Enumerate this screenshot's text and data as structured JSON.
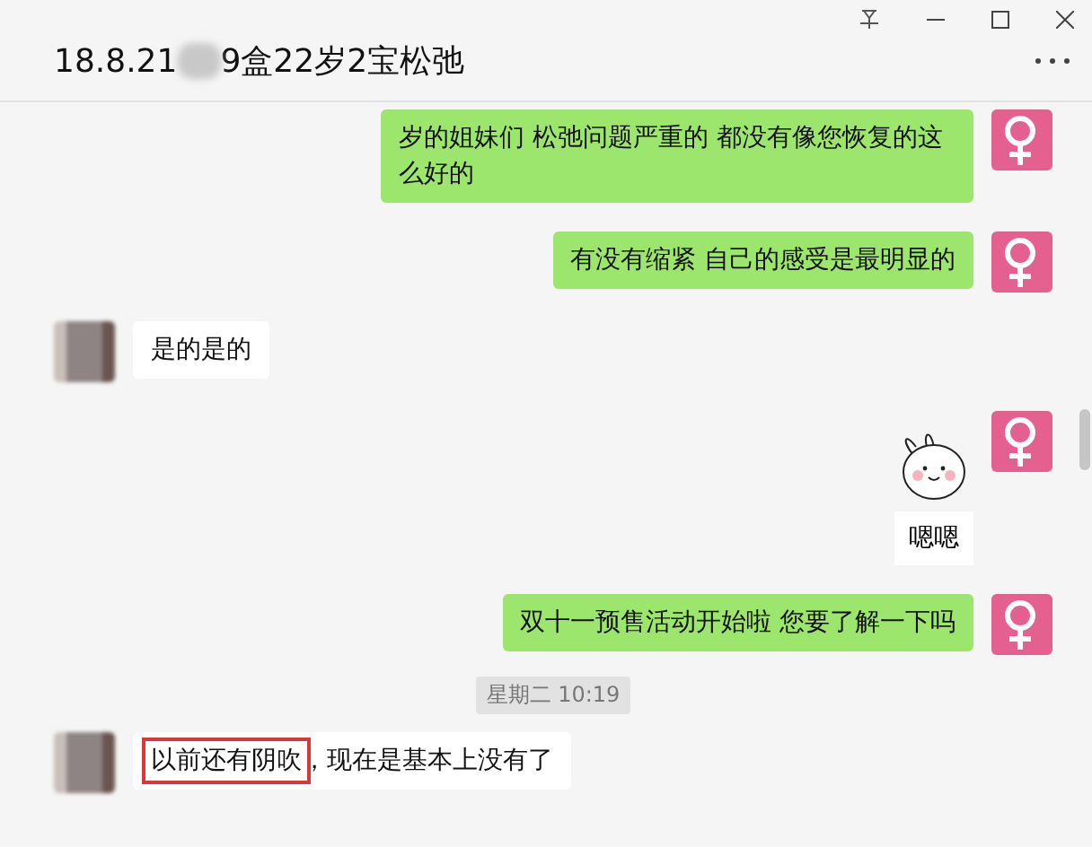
{
  "window": {
    "title_start": "18.8.21",
    "title_end": "9盒22岁2宝松弛"
  },
  "messages": [
    {
      "kind": "text",
      "outgoing": true,
      "parts": [
        {
          "text": "岁的姐妹们 松弛问题严重的 都没有像您恢复的这么好的",
          "boxed": false
        }
      ]
    },
    {
      "kind": "text",
      "outgoing": true,
      "parts": [
        {
          "text": "有没有缩紧 自己的感受是最明显的",
          "boxed": false
        }
      ]
    },
    {
      "kind": "text",
      "outgoing": false,
      "parts": [
        {
          "text": "是的是的",
          "boxed": false
        }
      ]
    },
    {
      "kind": "sticker",
      "outgoing": true,
      "caption": "嗯嗯"
    },
    {
      "kind": "text",
      "outgoing": true,
      "parts": [
        {
          "text": "双十一预售活动开始啦 您要了解一下吗",
          "boxed": false
        }
      ]
    },
    {
      "kind": "time",
      "text": "星期二 10:19"
    },
    {
      "kind": "text",
      "outgoing": false,
      "parts": [
        {
          "text": "以前还有阴吹",
          "boxed": true
        },
        {
          "text": "，现在是基本上没有了",
          "boxed": false
        }
      ]
    }
  ]
}
